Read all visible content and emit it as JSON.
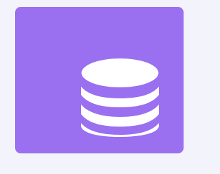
{
  "page": {
    "background_color": "#f3f4fb"
  },
  "tile": {
    "color": "#9a6ff0",
    "icon": "database-icon",
    "icon_color": "#ffffff"
  }
}
